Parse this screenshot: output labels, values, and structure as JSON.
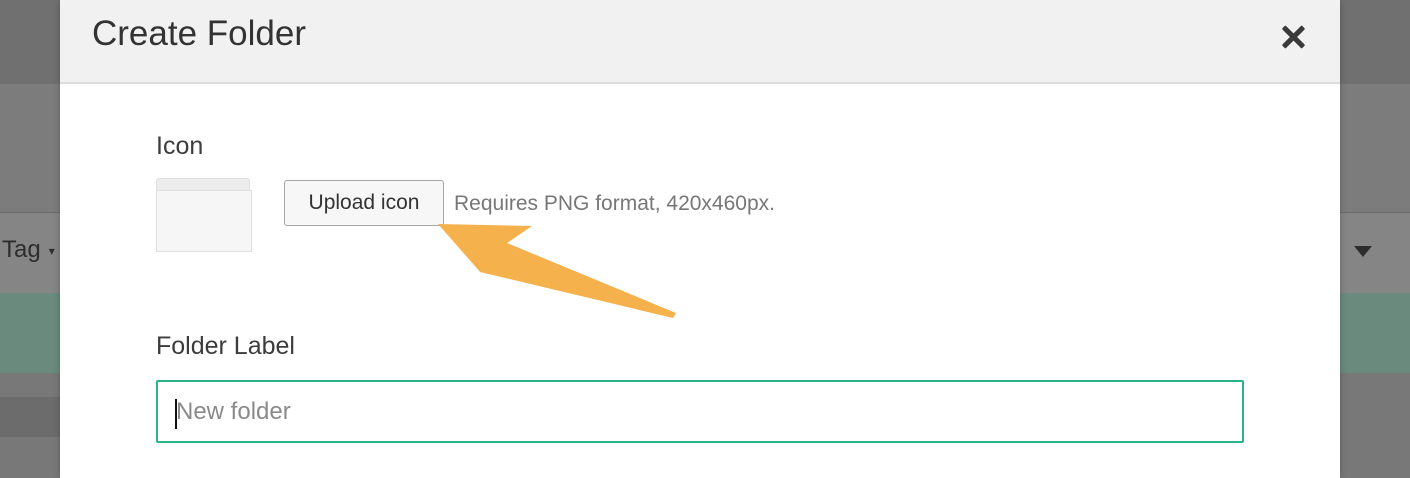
{
  "background": {
    "toolbar_tag_label": "Tag",
    "caret_glyph": "▾"
  },
  "modal": {
    "title": "Create Folder",
    "close_icon": "close-icon",
    "icon_section": {
      "label": "Icon",
      "preview_icon": "folder-icon",
      "upload_button_label": "Upload icon",
      "hint": "Requires PNG format, 420x460px."
    },
    "folder_label_section": {
      "label": "Folder Label",
      "input_value": "",
      "input_placeholder": "New folder"
    }
  },
  "annotation": {
    "arrow_color": "#f5b14c",
    "arrow_icon": "arrow-pointer-icon"
  },
  "colors": {
    "accent_focus_border": "#2ab487",
    "modal_header_bg": "#f1f1f1",
    "overlay_bg": "#7a7a7a"
  }
}
